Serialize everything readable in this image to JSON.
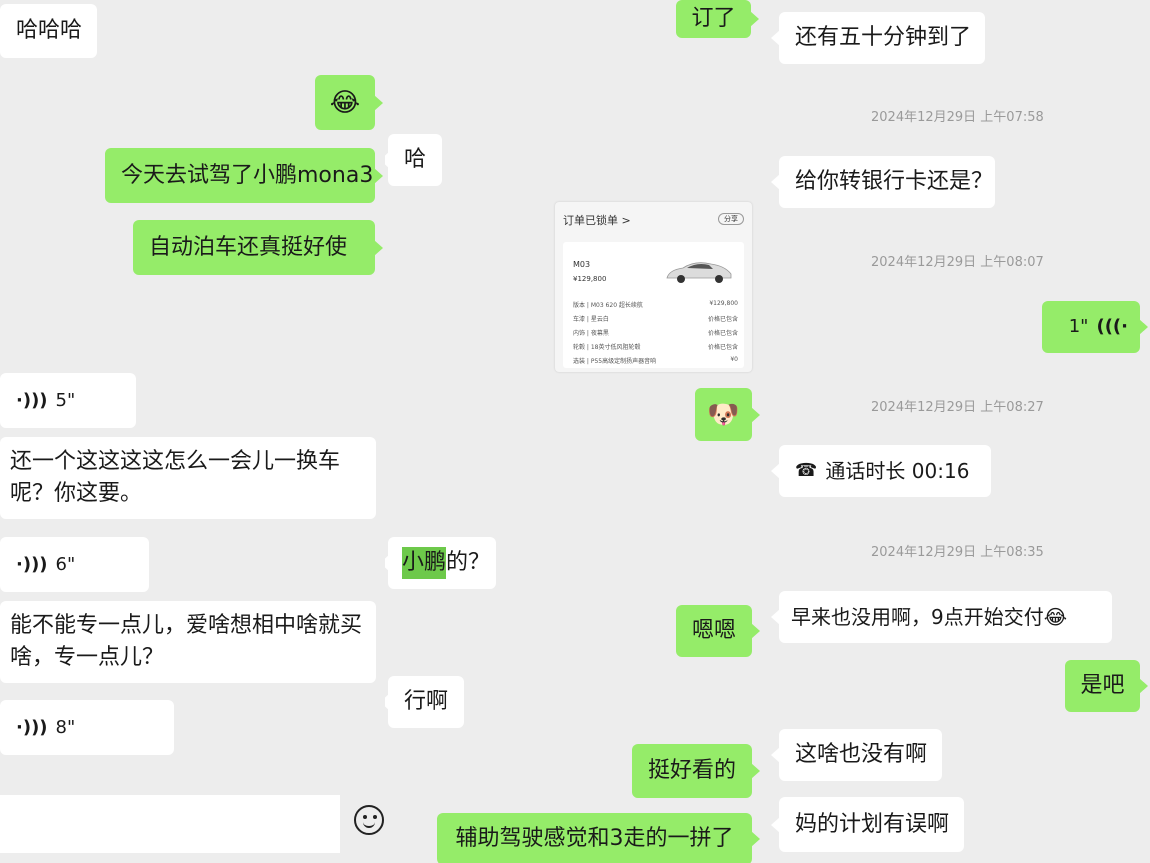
{
  "col1": {
    "msg_haha": "哈哈哈",
    "emoji_laugh": "😂",
    "msg_testdrive": "今天去试驾了小鹏mona3",
    "msg_parking": "自动泊车还真挺好使",
    "voice1": "5\"",
    "msg_change_car": "还一个这这这这怎么一会儿一换车呢？你这要。",
    "voice2": "6\"",
    "msg_focus": "能不能专一点儿，爱啥想相中啥就买啥，专一点儿？",
    "voice3": "8\""
  },
  "col2": {
    "msg_ha": "哈",
    "msg_xpeng_hl": "小鹏",
    "msg_xpeng_rest": "的？",
    "msg_ok": "行啊",
    "msg_ordered": "订了",
    "order_card": {
      "title": "订单已锁单 >",
      "share": "分享",
      "model": "M03",
      "price": "¥129,800",
      "specs": [
        {
          "k": "版本 | M03 620 超长续航",
          "v": "¥129,800"
        },
        {
          "k": "车漆 | 星云白",
          "v": "价格已包含"
        },
        {
          "k": "内饰 | 夜幕黑",
          "v": "价格已包含"
        },
        {
          "k": "轮毂 | 18英寸低风阻轮毂",
          "v": "价格已包含"
        },
        {
          "k": "选装 | P55高级定制扬声器音响",
          "v": "¥0"
        }
      ]
    },
    "msg_doge": "🐶",
    "msg_enen": "嗯嗯",
    "msg_looks_good": "挺好看的",
    "msg_adas": "辅助驾驶感觉和3走的一拼了"
  },
  "col3": {
    "msg_50min": "还有五十分钟到了",
    "ts1": "2024年12月29日  上午07:58",
    "msg_bank": "给你转银行卡还是？",
    "ts2": "2024年12月29日  上午08:07",
    "voice4": "1\"",
    "ts3": "2024年12月29日  上午08:27",
    "call_label": "通话时长  00:16",
    "ts4": "2024年12月29日  上午08:35",
    "msg_9am": "早来也没用啊，9点开始交付😂",
    "msg_right": "是吧",
    "msg_nothing": "这啥也没有啊",
    "msg_plan": "妈的计划有误啊"
  },
  "colors": {
    "green_bubble": "#95ec69",
    "white_bubble": "#ffffff",
    "bg": "#ededed"
  }
}
